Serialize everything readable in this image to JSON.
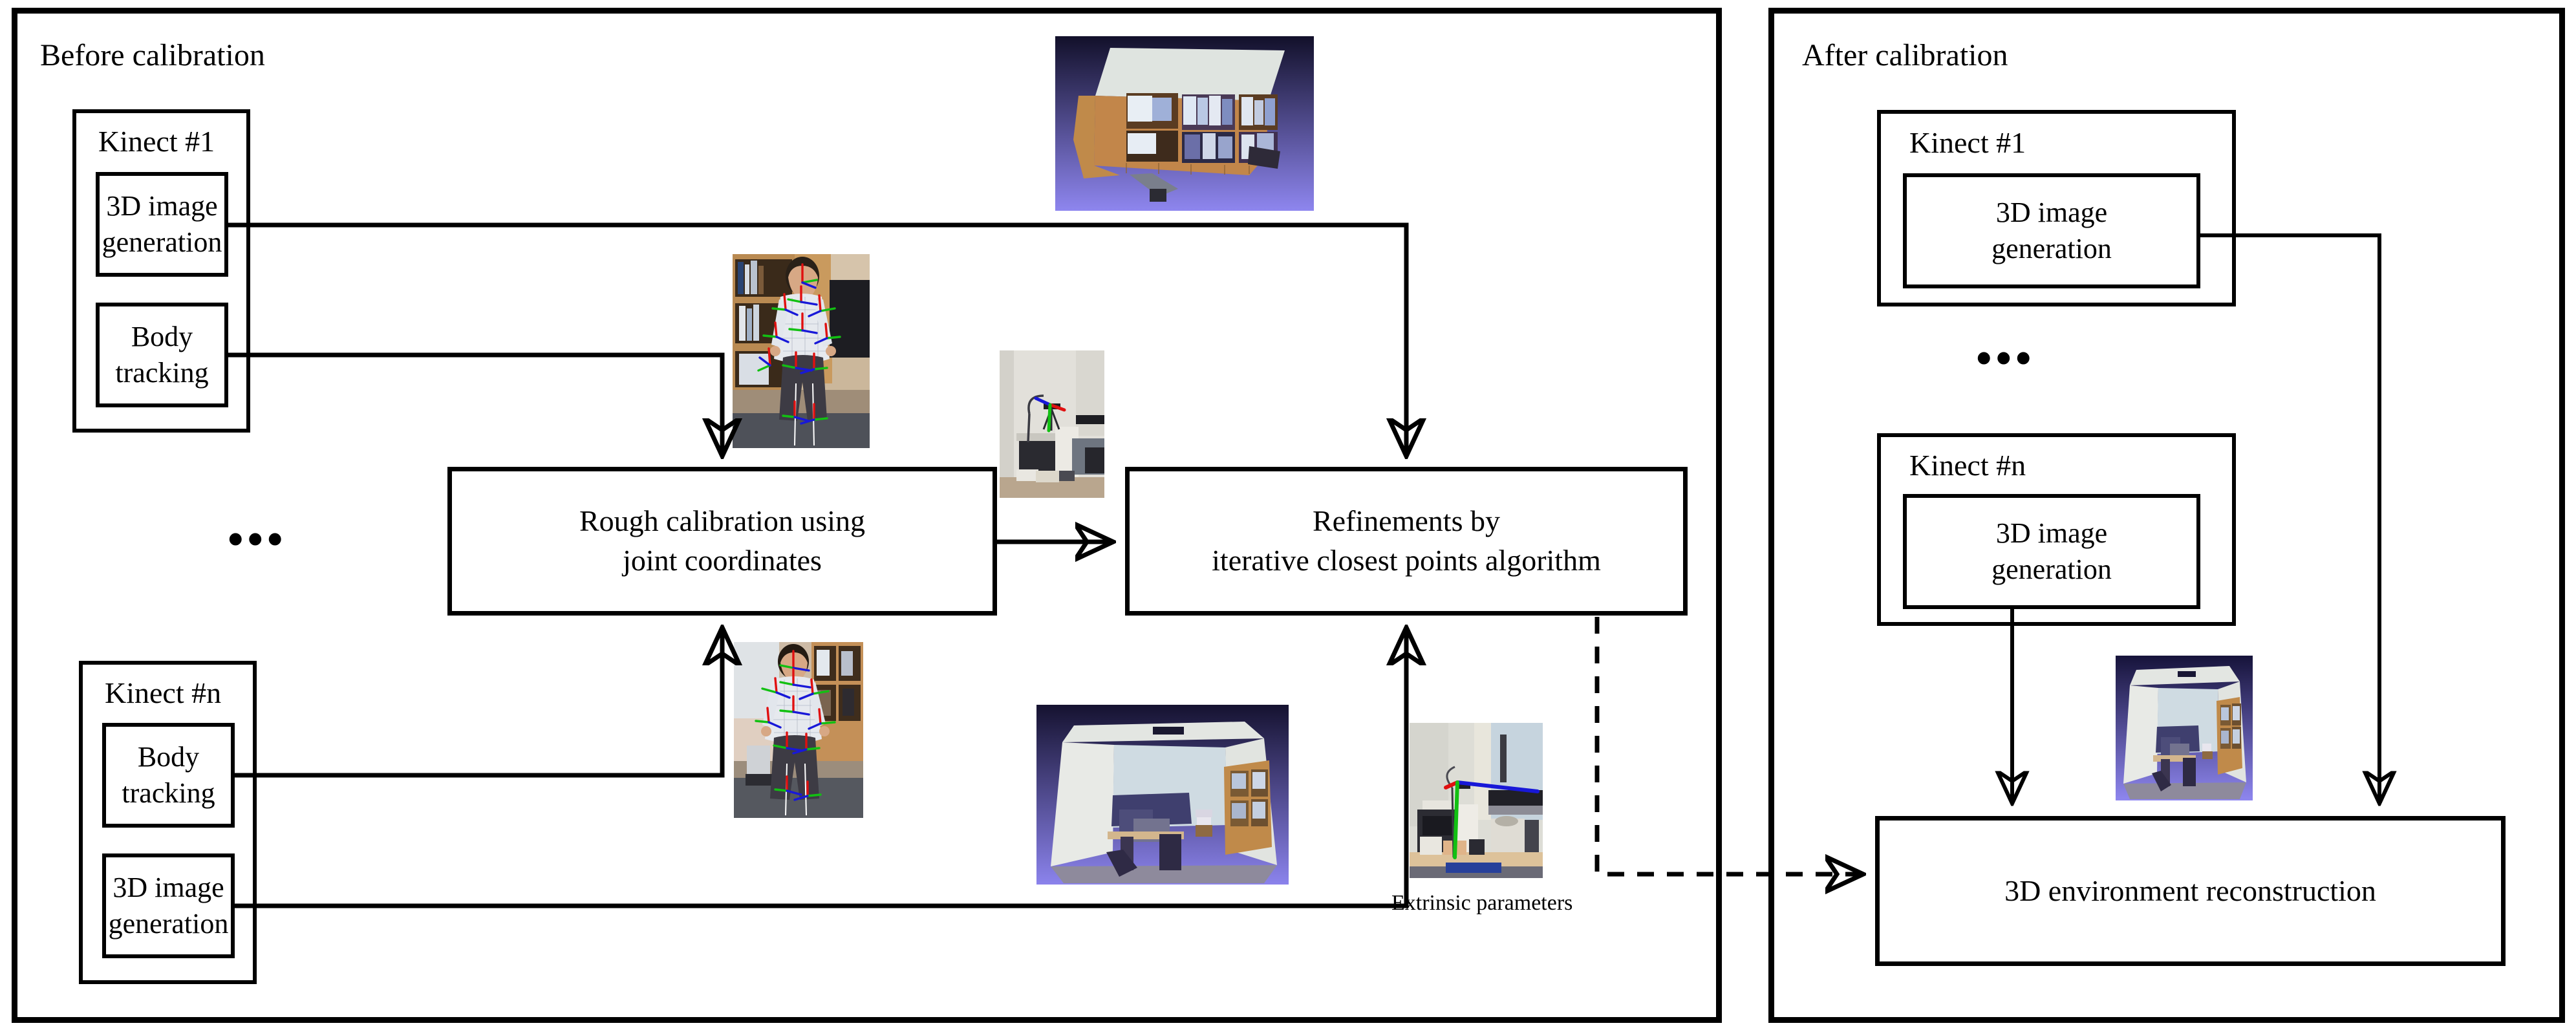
{
  "figure": {
    "left_panel": {
      "title": "Before calibration",
      "kinect_first": {
        "label": "Kinect #1",
        "modules": [
          {
            "label": "3D image\ngeneration",
            "line1": "3D image",
            "line2": "generation"
          },
          {
            "label": "Body tracking",
            "line1": "Body tracking",
            "line2": ""
          }
        ]
      },
      "vertical_ellipsis": "•••",
      "kinect_last": {
        "label": "Kinect #n",
        "modules": [
          {
            "label": "Body tracking",
            "line1": "Body tracking",
            "line2": ""
          },
          {
            "label": "3D image\ngeneration",
            "line1": "3D image",
            "line2": "generation"
          }
        ]
      },
      "stages": [
        {
          "line1": "Rough calibration using",
          "line2": "joint coordinates"
        },
        {
          "line1": "Refinements by",
          "line2": "iterative closest points algorithm"
        }
      ],
      "output_caption": "Extrinsic parameters"
    },
    "right_panel": {
      "title": "After calibration",
      "kinect_first": {
        "label": "Kinect #1",
        "modules": [
          {
            "line1": "3D image",
            "line2": "generation"
          }
        ]
      },
      "vertical_ellipsis": "•••",
      "kinect_last": {
        "label": "Kinect #n",
        "modules": [
          {
            "line1": "3D image",
            "line2": "generation"
          }
        ]
      },
      "output": {
        "label": "3D environment reconstruction"
      }
    },
    "thumbnails": [
      {
        "name": "cabinet-point-cloud",
        "alt": "3D point cloud of a bookshelf cabinet on purple background"
      },
      {
        "name": "skeleton-person-top",
        "alt": "Person with tracked body joint coordinate frames"
      },
      {
        "name": "kinect-on-tripod",
        "alt": "Kinect sensor on tripod with RGB axis overlay"
      },
      {
        "name": "skeleton-person-bottom",
        "alt": "Second view of person with tracked joint frames"
      },
      {
        "name": "room-point-cloud-left",
        "alt": "3D point cloud of a room interior"
      },
      {
        "name": "extrinsic-axes-photo",
        "alt": "Desk scene with green and blue extrinsic axis overlay"
      },
      {
        "name": "room-point-cloud-right",
        "alt": "Reconstructed 3D point cloud of the room"
      }
    ],
    "colors": {
      "stroke": "#000000",
      "background": "#ffffff",
      "axis_x": "#e01010",
      "axis_y": "#12c012",
      "axis_z": "#1818d8",
      "cloud_bg_top": "#12102a",
      "cloud_bg_bottom": "#7a72e0",
      "wood": "#c08a4a"
    }
  }
}
